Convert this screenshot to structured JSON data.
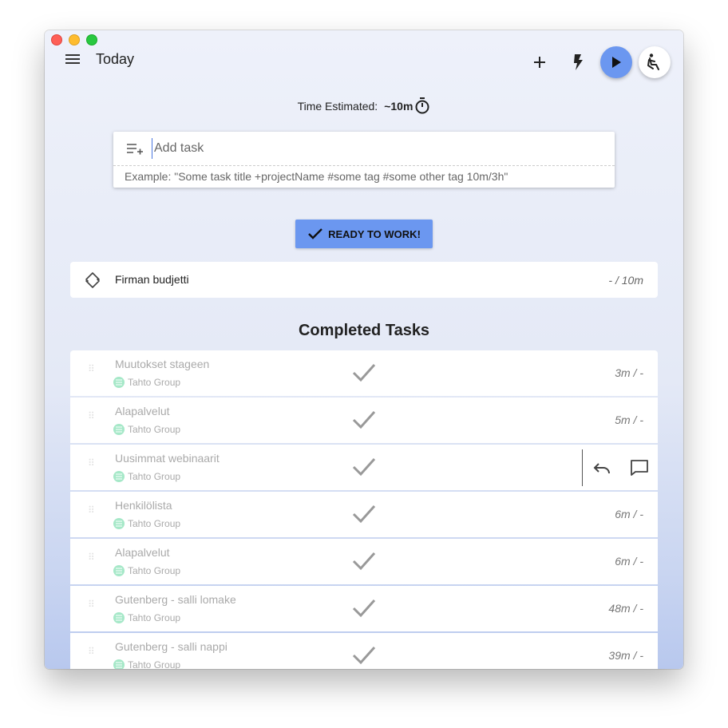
{
  "header": {
    "title": "Today",
    "add_icon": "plus-icon",
    "flash_icon": "flash-icon",
    "play_icon": "play-icon",
    "posture_icon": "seated-posture-icon"
  },
  "estimate": {
    "label": "Time Estimated:",
    "value": "~10m",
    "icon": "timer-icon"
  },
  "add_task": {
    "placeholder": "Add task",
    "example": "Example: \"Some task title +projectName #some tag #some other tag 10m/3h\""
  },
  "ready_button": {
    "label": "READY TO WORK!"
  },
  "current_task": {
    "title": "Firman budjetti",
    "time": "- / 10m"
  },
  "completed": {
    "heading": "Completed Tasks",
    "tasks": [
      {
        "title": "Muutokset stageen",
        "project": "Tahto Group",
        "time": "3m / -"
      },
      {
        "title": "Alapalvelut",
        "project": "Tahto Group",
        "time": "5m / -"
      },
      {
        "title": "Uusimmat webinaarit",
        "project": "Tahto Group",
        "time": ""
      },
      {
        "title": "Henkilölista",
        "project": "Tahto Group",
        "time": "6m / -"
      },
      {
        "title": "Alapalvelut",
        "project": "Tahto Group",
        "time": "6m / -"
      },
      {
        "title": "Gutenberg - salli lomake",
        "project": "Tahto Group",
        "time": "48m / -"
      },
      {
        "title": "Gutenberg - salli nappi",
        "project": "Tahto Group",
        "time": "39m / -"
      }
    ]
  },
  "colors": {
    "accent": "#6b97f0",
    "project_dot": "#a6e8c8"
  }
}
